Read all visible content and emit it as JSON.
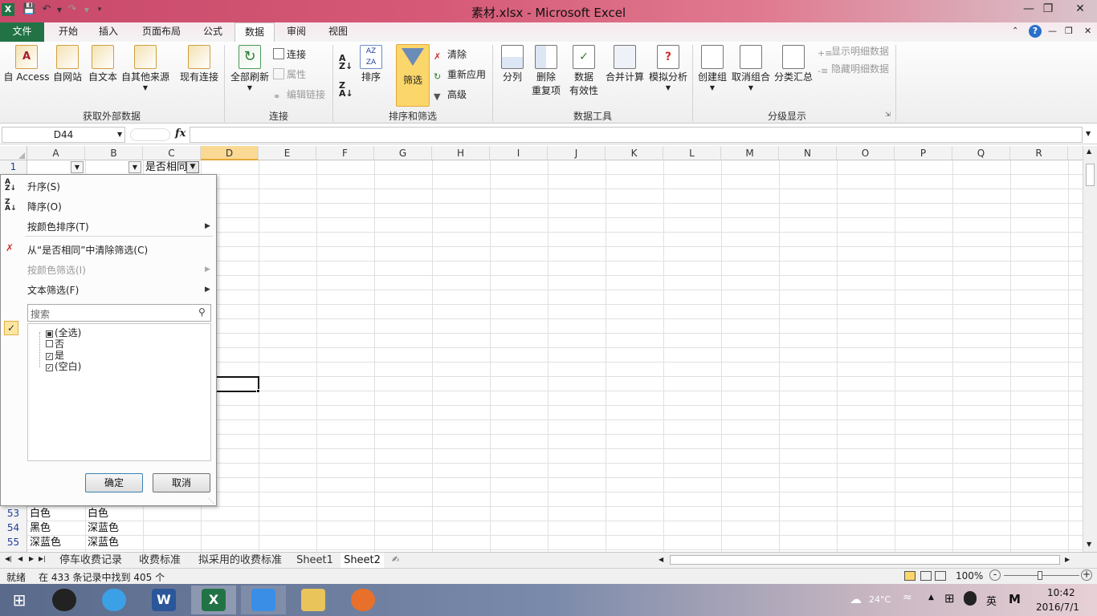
{
  "window": {
    "title": "素材.xlsx - Microsoft Excel"
  },
  "ribbon_tabs": [
    "文件",
    "开始",
    "插入",
    "页面布局",
    "公式",
    "数据",
    "审阅",
    "视图"
  ],
  "ribbon": {
    "groups": {
      "external": "获取外部数据",
      "connections": "连接",
      "sort_filter": "排序和筛选",
      "data_tools": "数据工具",
      "outline": "分级显示"
    },
    "buttons": {
      "access": "自 Access",
      "web": "自网站",
      "text": "自文本",
      "other": "自其他来源",
      "existing": "现有连接",
      "refresh_all": "全部刷新",
      "connections": "连接",
      "properties": "属性",
      "edit_links": "编辑链接",
      "sort": "排序",
      "filter": "筛选",
      "clear": "清除",
      "reapply": "重新应用",
      "advanced": "高级",
      "text_to_cols": "分列",
      "remove_dup_1": "删除",
      "remove_dup_2": "重复项",
      "validation_1": "数据",
      "validation_2": "有效性",
      "consolidate": "合并计算",
      "whatif": "模拟分析",
      "group": "创建组",
      "ungroup": "取消组合",
      "subtotal": "分类汇总",
      "show_detail": "显示明细数据",
      "hide_detail": "隐藏明细数据"
    }
  },
  "formula_bar": {
    "name_box": "D44",
    "fx": "fx",
    "formula": ""
  },
  "columns": [
    "A",
    "B",
    "C",
    "D",
    "E",
    "F",
    "G",
    "H",
    "I",
    "J",
    "K",
    "L",
    "M",
    "N",
    "O",
    "P",
    "Q",
    "R"
  ],
  "selected_column": "D",
  "row1": {
    "num": "1",
    "c_header": "是否相同"
  },
  "rows": [
    {
      "num": "53",
      "a": "白色",
      "b": "白色"
    },
    {
      "num": "54",
      "a": "黑色",
      "b": "深蓝色"
    },
    {
      "num": "55",
      "a": "深蓝色",
      "b": "深蓝色"
    }
  ],
  "filter_menu": {
    "sort_asc": "升序(S)",
    "sort_desc": "降序(O)",
    "sort_color": "按颜色排序(T)",
    "clear_filter": "从“是否相同”中清除筛选(C)",
    "filter_color": "按颜色筛选(I)",
    "text_filter": "文本筛选(F)",
    "search_placeholder": "搜索",
    "items": [
      {
        "label": "(全选)",
        "state": "partial"
      },
      {
        "label": "否",
        "state": "unchecked"
      },
      {
        "label": "是",
        "state": "checked"
      },
      {
        "label": "(空白)",
        "state": "checked"
      }
    ],
    "ok": "确定",
    "cancel": "取消"
  },
  "sheet_tabs": [
    "停车收费记录",
    "收费标准",
    "拟采用的收费标准",
    "Sheet1",
    "Sheet2"
  ],
  "active_sheet": "Sheet2",
  "status": {
    "ready": "就绪",
    "message": "在 433 条记录中找到 405 个",
    "zoom": "100%"
  },
  "tray": {
    "weather": "24°C",
    "ime": "英",
    "time": "10:42",
    "date": "2016/7/1"
  },
  "colors": {
    "excel_green": "#217346",
    "title_pink": "#d65a77",
    "accent_blue": "#1f3f9a"
  }
}
